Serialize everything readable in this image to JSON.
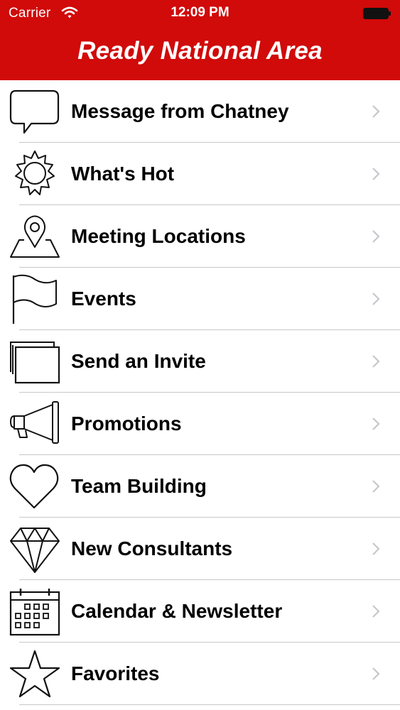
{
  "status_bar": {
    "carrier": "Carrier",
    "time": "12:09 PM"
  },
  "header": {
    "title": "Ready National Area",
    "background_color": "#d10a0a"
  },
  "menu": {
    "items": [
      {
        "label": "Message from Chatney",
        "icon": "speech-bubble-icon"
      },
      {
        "label": "What's Hot",
        "icon": "sun-icon"
      },
      {
        "label": "Meeting Locations",
        "icon": "map-pin-icon"
      },
      {
        "label": "Events",
        "icon": "flag-icon"
      },
      {
        "label": "Send an Invite",
        "icon": "cards-icon"
      },
      {
        "label": "Promotions",
        "icon": "megaphone-icon"
      },
      {
        "label": "Team Building",
        "icon": "heart-icon"
      },
      {
        "label": "New Consultants",
        "icon": "diamond-icon"
      },
      {
        "label": "Calendar & Newsletter",
        "icon": "calendar-icon"
      },
      {
        "label": "Favorites",
        "icon": "star-icon"
      }
    ]
  }
}
